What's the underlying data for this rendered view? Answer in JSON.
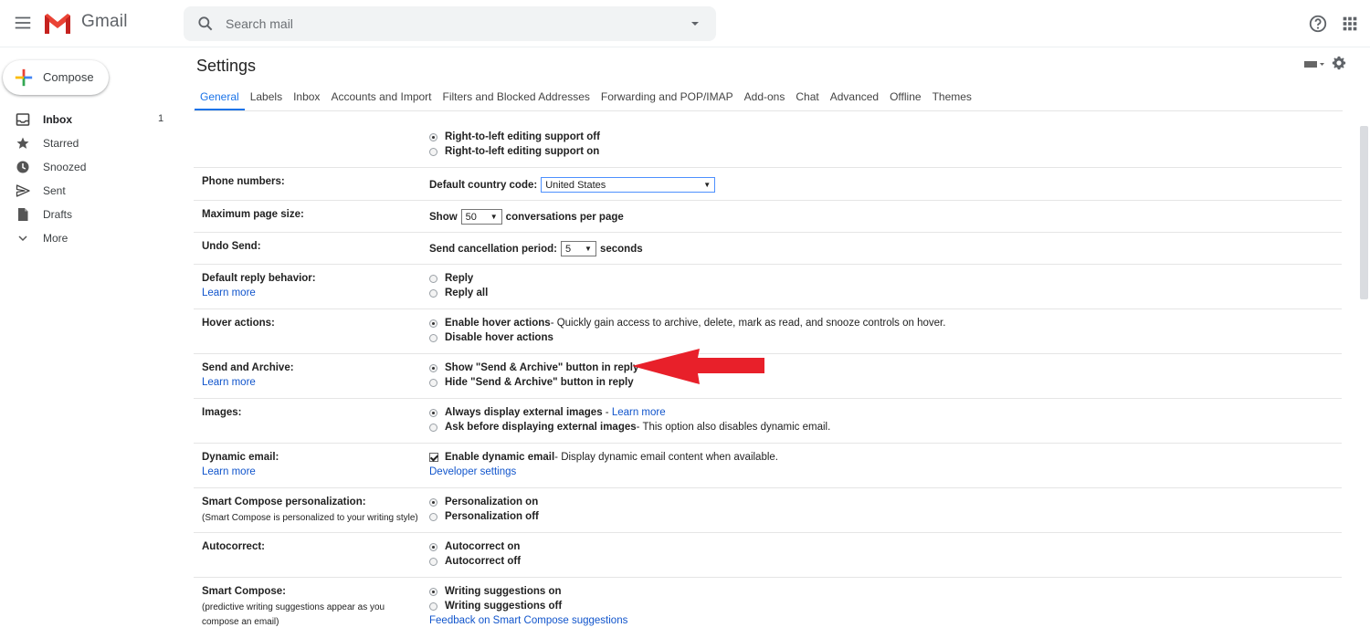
{
  "app": {
    "logo_text": "Gmail",
    "search_placeholder": "Search mail"
  },
  "sidebar": {
    "compose_label": "Compose",
    "items": [
      {
        "label": "Inbox",
        "count": "1",
        "icon": "inbox-icon",
        "bold": true
      },
      {
        "label": "Starred",
        "count": "",
        "icon": "star-icon"
      },
      {
        "label": "Snoozed",
        "count": "",
        "icon": "clock-icon"
      },
      {
        "label": "Sent",
        "count": "",
        "icon": "send-icon"
      },
      {
        "label": "Drafts",
        "count": "",
        "icon": "draft-icon"
      },
      {
        "label": "More",
        "count": "",
        "icon": "chevron-down-icon"
      }
    ]
  },
  "settings": {
    "title": "Settings",
    "tabs": [
      "General",
      "Labels",
      "Inbox",
      "Accounts and Import",
      "Filters and Blocked Addresses",
      "Forwarding and POP/IMAP",
      "Add-ons",
      "Chat",
      "Advanced",
      "Offline",
      "Themes"
    ],
    "rtl": {
      "off": "Right-to-left editing support off",
      "on": "Right-to-left editing support on"
    },
    "phone": {
      "label": "Phone numbers:",
      "prefix": "Default country code:",
      "value": "United States"
    },
    "page_size": {
      "label": "Maximum page size:",
      "prefix": "Show",
      "value": "50",
      "suffix": "conversations per page"
    },
    "undo": {
      "label": "Undo Send:",
      "prefix": "Send cancellation period:",
      "value": "5",
      "suffix": "seconds"
    },
    "reply": {
      "label": "Default reply behavior:",
      "learn": "Learn more",
      "opt1": "Reply",
      "opt2": "Reply all"
    },
    "hover": {
      "label": "Hover actions:",
      "opt1": "Enable hover actions",
      "opt1_desc": " - Quickly gain access to archive, delete, mark as read, and snooze controls on hover.",
      "opt2": "Disable hover actions"
    },
    "send_archive": {
      "label": "Send and Archive:",
      "learn": "Learn more",
      "opt1": "Show \"Send & Archive\" button in reply",
      "opt2": "Hide \"Send & Archive\" button in reply"
    },
    "images": {
      "label": "Images:",
      "opt1": "Always display external images",
      "opt1_sep": " - ",
      "opt1_link": "Learn more",
      "opt2": "Ask before displaying external images",
      "opt2_desc": " - This option also disables dynamic email."
    },
    "dynamic": {
      "label": "Dynamic email:",
      "learn": "Learn more",
      "opt1": "Enable dynamic email",
      "opt1_desc": " - Display dynamic email content when available.",
      "dev_link": "Developer settings"
    },
    "personalization": {
      "label": "Smart Compose personalization:",
      "sub": "(Smart Compose is personalized to your writing style)",
      "opt1": "Personalization on",
      "opt2": "Personalization off"
    },
    "autocorrect": {
      "label": "Autocorrect:",
      "opt1": "Autocorrect on",
      "opt2": "Autocorrect off"
    },
    "smart_compose": {
      "label": "Smart Compose:",
      "sub1": "(predictive writing suggestions appear as you",
      "sub2": "compose an email)",
      "opt1": "Writing suggestions on",
      "opt2": "Writing suggestions off",
      "feedback": "Feedback on Smart Compose suggestions"
    }
  },
  "colors": {
    "accent": "#1a73e8",
    "link": "#1155cc",
    "arrow": "#e8202a"
  }
}
